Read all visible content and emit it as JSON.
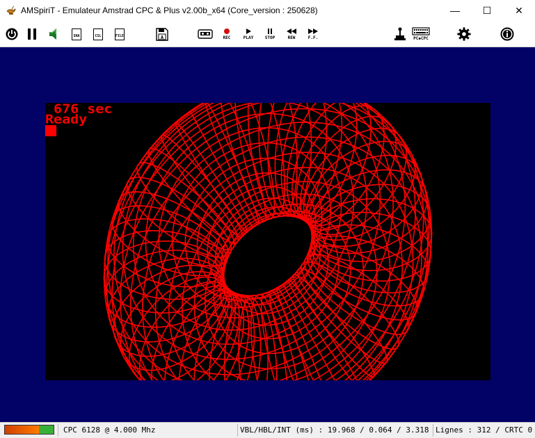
{
  "window": {
    "title": "AMSpiriT - Emulateur Amstrad CPC & Plus v2.00b_x64 (Core_version : 250628)",
    "app_icon": "amspirit-lamp-icon",
    "minimize_glyph": "—",
    "maximize_glyph": "☐",
    "close_glyph": "✕"
  },
  "toolbar": {
    "sna_label": "SNA",
    "csl_label": "CSL",
    "file_label": "FILE",
    "disk_letter": "A",
    "rec_label": "REC",
    "play_label": "PLAY",
    "stop_label": "STOP",
    "rew_label": "REW",
    "ff_label": "F.F.",
    "keyboard_label": "PC◆CPC",
    "icons": [
      "power-icon",
      "pause-icon",
      "speaker-icon",
      "sna-icon",
      "csl-icon",
      "file-icon",
      "floppy-icon",
      "cassette-icon",
      "record-icon",
      "play-icon",
      "stop-icon",
      "rewind-icon",
      "fast-forward-icon",
      "joystick-icon",
      "keyboard-icon",
      "gear-icon",
      "info-icon"
    ]
  },
  "screen": {
    "line1": " 676 sec",
    "line2": "Ready",
    "ink_color": "#ff0000",
    "paper_color": "#000000",
    "border_color": "#020266"
  },
  "status": {
    "cpu_load": 0.7,
    "model": "CPC 6128 @ 4.000 Mhz",
    "timing": "VBL/HBL/INT (ms) : 19.968 / 0.064 / 3.318",
    "lines": "Lignes : 312 / CRTC 0"
  }
}
